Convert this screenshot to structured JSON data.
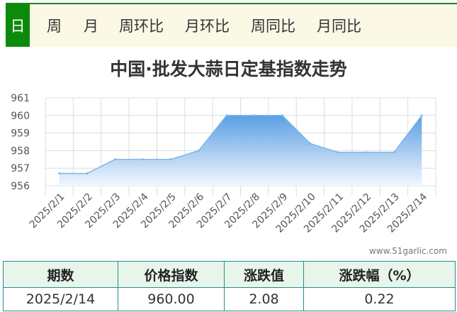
{
  "tabs": [
    {
      "label": "日",
      "active": true
    },
    {
      "label": "周",
      "active": false
    },
    {
      "label": "月",
      "active": false
    },
    {
      "label": "周环比",
      "active": false
    },
    {
      "label": "月环比",
      "active": false
    },
    {
      "label": "周同比",
      "active": false
    },
    {
      "label": "月同比",
      "active": false
    }
  ],
  "chart_data": {
    "type": "area",
    "title": "中国·批发大蒜日定基指数走势",
    "categories": [
      "2025/2/1",
      "2025/2/2",
      "2025/2/3",
      "2025/2/4",
      "2025/2/5",
      "2025/2/6",
      "2025/2/7",
      "2025/2/8",
      "2025/2/9",
      "2025/2/10",
      "2025/2/11",
      "2025/2/12",
      "2025/2/13",
      "2025/2/14"
    ],
    "values": [
      956.7,
      956.7,
      957.5,
      957.5,
      957.5,
      958.0,
      960.0,
      960.0,
      960.0,
      958.4,
      957.9,
      957.9,
      957.9,
      960.0
    ],
    "ylim": [
      956,
      961
    ],
    "yticks": [
      956,
      957,
      958,
      959,
      960,
      961
    ],
    "grid": true,
    "line_color": "#7fb6e6",
    "fill_top_color": "#5b9fe4",
    "fill_bottom_color": "#f2f7fd"
  },
  "watermark": "www.51garlic.com",
  "summary": {
    "headers": [
      "期数",
      "价格指数",
      "涨跌值",
      "涨跌幅（%）"
    ],
    "row": [
      "2025/2/14",
      "960.00",
      "2.08",
      "0.22"
    ]
  }
}
